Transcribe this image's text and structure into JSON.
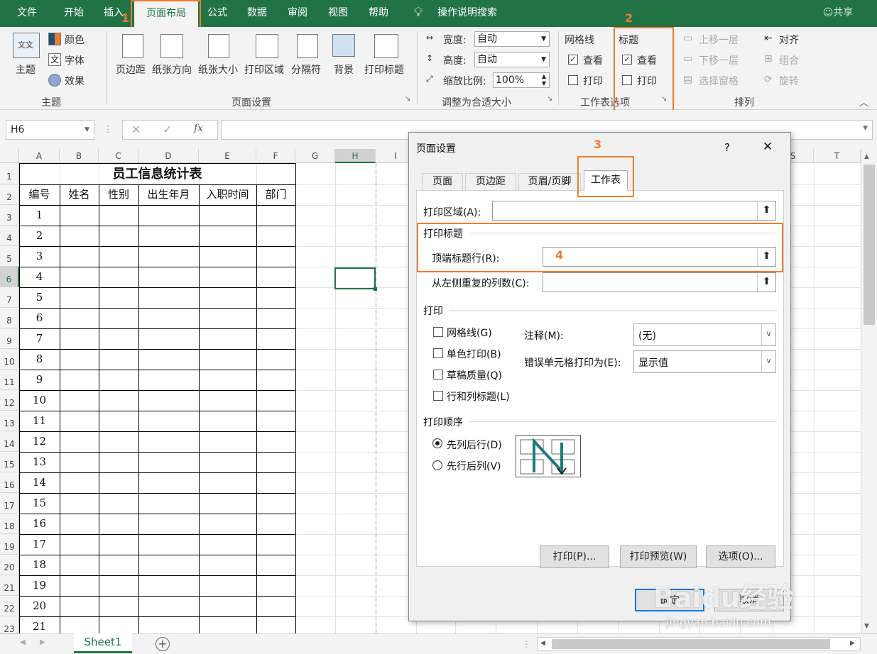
{
  "tabs": [
    "文件",
    "开始",
    "插入",
    "页面布局",
    "公式",
    "数据",
    "审阅",
    "视图",
    "帮助"
  ],
  "tell_me": "操作说明搜索",
  "share": "共享",
  "ribbon": {
    "theme_label": "主题",
    "colors": "颜色",
    "fonts": "字体",
    "effects": "效果",
    "group_theme": "主题",
    "margins": "页边距",
    "orientation": "纸张方向",
    "size": "纸张大小",
    "print_area": "打印区域",
    "breaks": "分隔符",
    "background": "背景",
    "print_titles": "打印标题",
    "group_page_setup": "页面设置",
    "width_label": "宽度:",
    "width_val": "自动",
    "height_label": "高度:",
    "height_val": "自动",
    "scale_label": "缩放比例:",
    "scale_val": "100%",
    "group_scale": "调整为合适大小",
    "gridlines": "网格线",
    "headings": "标题",
    "view": "查看",
    "print": "打印",
    "group_sheet_options": "工作表选项",
    "bring_forward": "上移一层",
    "send_backward": "下移一层",
    "selection_pane": "选择窗格",
    "align": "对齐",
    "group": "组合",
    "rotate": "旋转",
    "group_arrange": "排列"
  },
  "name_box": "H6",
  "fx": "fx",
  "columns": [
    "A",
    "B",
    "C",
    "D",
    "E",
    "F",
    "G",
    "H",
    "I",
    "S",
    "T"
  ],
  "rows": [
    "1",
    "2",
    "3",
    "4",
    "5",
    "6",
    "7",
    "8",
    "9",
    "10",
    "11",
    "12",
    "13",
    "14",
    "15",
    "16",
    "17",
    "18",
    "19",
    "20",
    "21",
    "22",
    "23"
  ],
  "table": {
    "title": "员工信息统计表",
    "headers": [
      "编号",
      "姓名",
      "性别",
      "出生年月",
      "入职时间",
      "部门"
    ],
    "ids": [
      "1",
      "2",
      "3",
      "4",
      "5",
      "6",
      "7",
      "8",
      "9",
      "10",
      "11",
      "12",
      "13",
      "14",
      "15",
      "16",
      "17",
      "18",
      "19",
      "20",
      "21"
    ]
  },
  "dialog": {
    "title": "页面设置",
    "help": "?",
    "close": "✕",
    "tabs": [
      "页面",
      "页边距",
      "页眉/页脚",
      "工作表"
    ],
    "print_area": "打印区域(A):",
    "print_titles": "打印标题",
    "rows_to_repeat": "顶端标题行(R):",
    "cols_to_repeat": "从左侧重复的列数(C):",
    "print_section": "打印",
    "gridlines": "网格线(G)",
    "black_white": "单色打印(B)",
    "draft": "草稿质量(Q)",
    "row_col_headings": "行和列标题(L)",
    "comments_label": "注释(M):",
    "comments_val": "(无)",
    "errors_label": "错误单元格打印为(E):",
    "errors_val": "显示值",
    "page_order": "打印顺序",
    "down_then_over": "先列后行(D)",
    "over_then_down": "先行后列(V)",
    "btn_print": "打印(P)...",
    "btn_preview": "打印预览(W)",
    "btn_options": "选项(O)...",
    "btn_ok": "确定",
    "btn_cancel": "取消"
  },
  "sheet_tab": "Sheet1",
  "annotations": [
    "1",
    "2",
    "3",
    "4"
  ],
  "watermark": "Baidu经验",
  "watermark_url": "jingyan.baidu.com",
  "colors": {
    "excel_green": "#217346",
    "annotation": "#ed7d31"
  }
}
